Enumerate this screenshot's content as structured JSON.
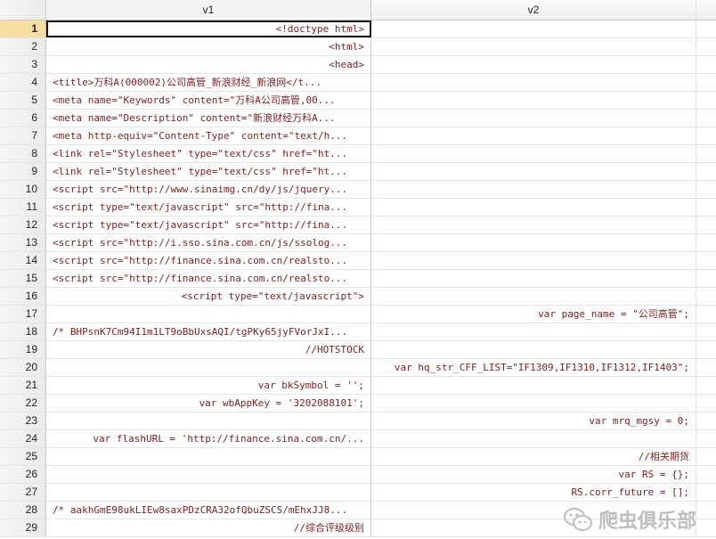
{
  "columns": [
    "v1",
    "v2"
  ],
  "rows": [
    {
      "n": "1",
      "v1": "<!doctype html>",
      "v1_align": "r",
      "v2": "",
      "v2_align": "r"
    },
    {
      "n": "2",
      "v1": "<html>",
      "v1_align": "r",
      "v2": "",
      "v2_align": "r"
    },
    {
      "n": "3",
      "v1": "<head>",
      "v1_align": "r",
      "v2": "",
      "v2_align": "r"
    },
    {
      "n": "4",
      "v1": "<title>万科A(000002)公司高管_新浪财经_新浪网</t...",
      "v1_align": "l",
      "v2": "",
      "v2_align": "r"
    },
    {
      "n": "5",
      "v1": "<meta name=\"Keywords\" content=\"万科A公司高管,00...",
      "v1_align": "l",
      "v2": "",
      "v2_align": "r"
    },
    {
      "n": "6",
      "v1": "<meta name=\"Description\" content=\"新浪财经万科A...",
      "v1_align": "l",
      "v2": "",
      "v2_align": "r"
    },
    {
      "n": "7",
      "v1": "<meta http-equiv=\"Content-Type\" content=\"text/h...",
      "v1_align": "l",
      "v2": "",
      "v2_align": "r"
    },
    {
      "n": "8",
      "v1": "<link rel=\"Stylesheet\" type=\"text/css\" href=\"ht...",
      "v1_align": "l",
      "v2": "",
      "v2_align": "r"
    },
    {
      "n": "9",
      "v1": "<link rel=\"Stylesheet\" type=\"text/css\" href=\"ht...",
      "v1_align": "l",
      "v2": "",
      "v2_align": "r"
    },
    {
      "n": "10",
      "v1": "<script src=\"http://www.sinaimg.cn/dy/js/jquery...",
      "v1_align": "l",
      "v2": "",
      "v2_align": "r"
    },
    {
      "n": "11",
      "v1": "<script type=\"text/javascript\" src=\"http://fina...",
      "v1_align": "l",
      "v2": "",
      "v2_align": "r"
    },
    {
      "n": "12",
      "v1": "<script type=\"text/javascript\" src=\"http://fina...",
      "v1_align": "l",
      "v2": "",
      "v2_align": "r"
    },
    {
      "n": "13",
      "v1": "<script src=\"http://i.sso.sina.com.cn/js/ssolog...",
      "v1_align": "l",
      "v2": "",
      "v2_align": "r"
    },
    {
      "n": "14",
      "v1": "<script src=\"http://finance.sina.com.cn/realsto...",
      "v1_align": "l",
      "v2": "",
      "v2_align": "r"
    },
    {
      "n": "15",
      "v1": "<script src=\"http://finance.sina.com.cn/realsto...",
      "v1_align": "l",
      "v2": "",
      "v2_align": "r"
    },
    {
      "n": "16",
      "v1": "<script type=\"text/javascript\">",
      "v1_align": "r",
      "v2": "",
      "v2_align": "r"
    },
    {
      "n": "17",
      "v1": "",
      "v1_align": "r",
      "v2": "var page_name = \"公司高管\";",
      "v2_align": "r"
    },
    {
      "n": "18",
      "v1": "/* BHPsnK7Cm94I1m1LT9oBbUxsAQI/tgPKy65jyFVorJxI...",
      "v1_align": "l",
      "v2": "",
      "v2_align": "r"
    },
    {
      "n": "19",
      "v1": "//HOTSTOCK",
      "v1_align": "r",
      "v2": "",
      "v2_align": "r"
    },
    {
      "n": "20",
      "v1": "",
      "v1_align": "r",
      "v2": "var hq_str_CFF_LIST=\"IF1309,IF1310,IF1312,IF1403\";",
      "v2_align": "r"
    },
    {
      "n": "21",
      "v1": "var bkSymbol = '';",
      "v1_align": "r",
      "v2": "",
      "v2_align": "r"
    },
    {
      "n": "22",
      "v1": "var wbAppKey = '3202088101';",
      "v1_align": "r",
      "v2": "",
      "v2_align": "r"
    },
    {
      "n": "23",
      "v1": "",
      "v1_align": "r",
      "v2": "var mrq_mgsy = 0;",
      "v2_align": "r"
    },
    {
      "n": "24",
      "v1": "var flashURL = 'http://finance.sina.com.cn/...",
      "v1_align": "r",
      "v2": "",
      "v2_align": "r"
    },
    {
      "n": "25",
      "v1": "",
      "v1_align": "r",
      "v2": "//相关期货",
      "v2_align": "r"
    },
    {
      "n": "26",
      "v1": "",
      "v1_align": "r",
      "v2": "var RS = {};",
      "v2_align": "r"
    },
    {
      "n": "27",
      "v1": "",
      "v1_align": "r",
      "v2": "RS.corr_future = [];",
      "v2_align": "r"
    },
    {
      "n": "28",
      "v1": "/* aakhGmE98ukLIEw8saxPDzCRA32ofQbuZSCS/mEhxJJ8...",
      "v1_align": "l",
      "v2": "",
      "v2_align": "r"
    },
    {
      "n": "29",
      "v1": "//综合评级级别",
      "v1_align": "r",
      "v2": "",
      "v2_align": "r"
    }
  ],
  "selected_row": "1",
  "watermark": {
    "text": "爬虫俱乐部",
    "icon": "wechat-icon"
  },
  "colors": {
    "cell_text": "#7a1f1f",
    "selected_row_header": "#f7dfa3",
    "watermark": "#bdbdbd"
  }
}
